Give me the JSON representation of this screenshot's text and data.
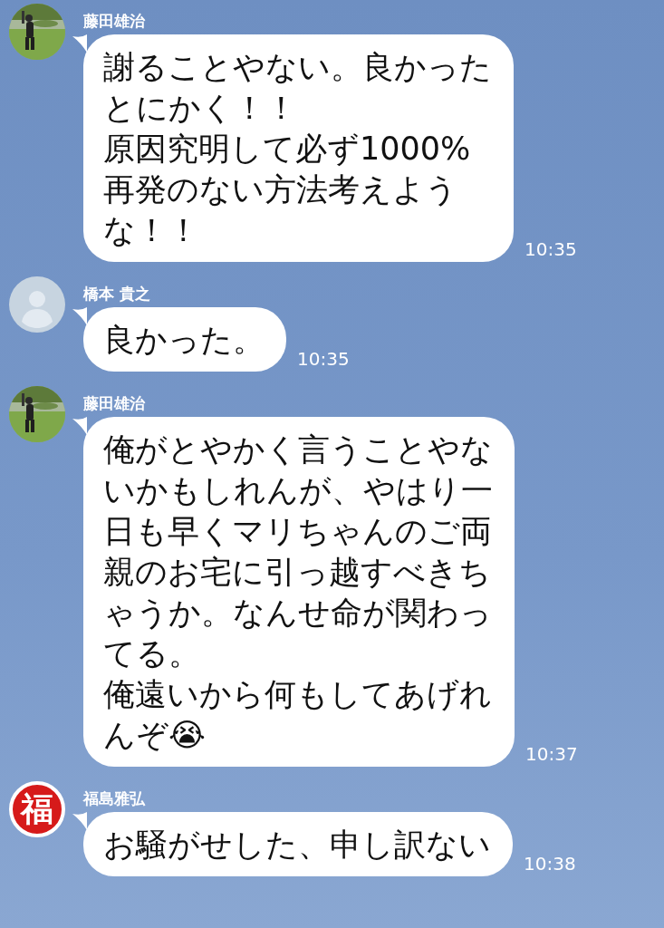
{
  "messages": [
    {
      "sender": "藤田雄治",
      "lines": [
        "謝ることやない。良かった",
        "とにかく！！",
        "原因究明して必ず1000%",
        "再発のない方法考えよう",
        "な！！"
      ],
      "time": "10:35"
    },
    {
      "sender": "橋本 貴之",
      "avatar": {
        "kind": "default"
      },
      "lines": [
        "良かった。"
      ],
      "time": "10:35"
    },
    {
      "sender": "藤田雄治",
      "lines": [
        "俺がとやかく言うことやな",
        "いかもしれんが、やはり一",
        "日も早くマリちゃんのご両",
        "親のお宅に引っ越すべきち",
        "ゃうか。なんせ命が関わっ",
        "てる。",
        "俺遠いから何もしてあげれ",
        "んぞ😭"
      ],
      "time": "10:37"
    },
    {
      "sender": "福島雅弘",
      "avatar": {
        "kind": "glyph",
        "text": "福"
      },
      "lines": [
        "お騒がせした、申し訳ない"
      ],
      "time": "10:38"
    }
  ]
}
